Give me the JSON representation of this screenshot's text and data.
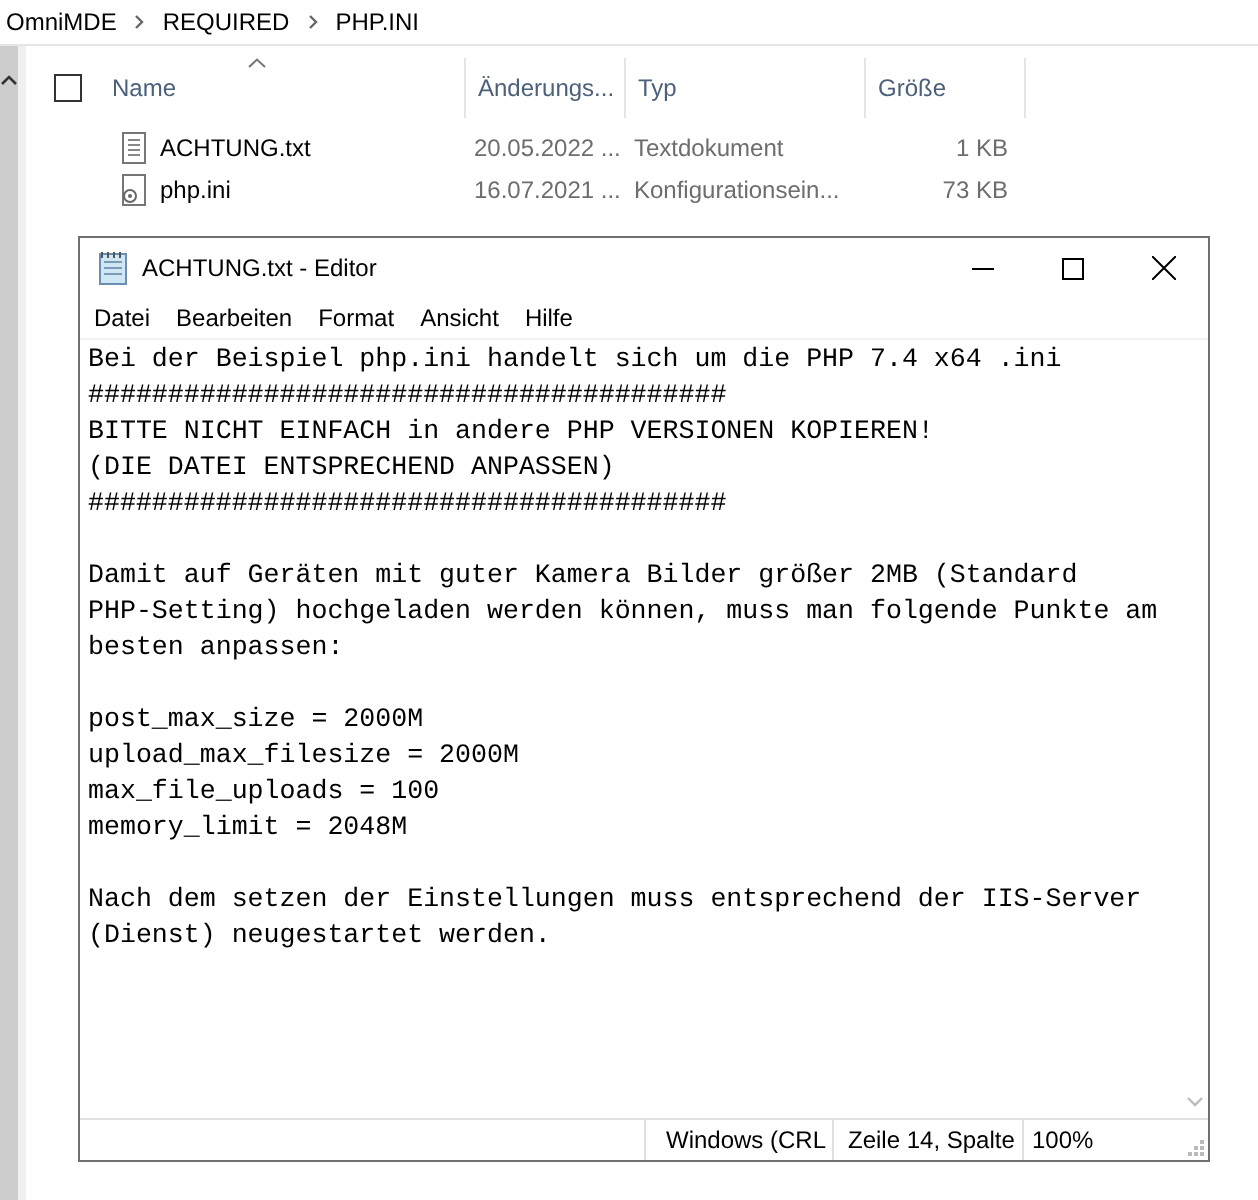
{
  "breadcrumb": [
    "OmniMDE",
    "REQUIRED",
    "PHP.INI"
  ],
  "file_list": {
    "select_all": {
      "checked": false
    },
    "columns": [
      {
        "label": "Name",
        "sorted": true
      },
      {
        "label": "Änderungs...",
        "sorted": false
      },
      {
        "label": "Typ",
        "sorted": false
      },
      {
        "label": "Größe",
        "sorted": false
      }
    ],
    "rows": [
      {
        "kind": "text",
        "name": "ACHTUNG.txt",
        "date": "20.05.2022 ...",
        "type": "Textdokument",
        "size": "1 KB"
      },
      {
        "kind": "config",
        "name": "php.ini",
        "date": "16.07.2021 ...",
        "type": "Konfigurationsein...",
        "size": "73 KB"
      }
    ]
  },
  "editor": {
    "title": "ACHTUNG.txt - Editor",
    "menu": [
      "Datei",
      "Bearbeiten",
      "Format",
      "Ansicht",
      "Hilfe"
    ],
    "paragraphs": [
      [
        "Bei der Beispiel php.ini handelt sich um die PHP 7.4 x64 .ini",
        "########################################",
        "BITTE NICHT EINFACH in andere PHP VERSIONEN KOPIEREN!",
        "(DIE DATEI ENTSPRECHEND ANPASSEN)",
        "########################################"
      ],
      [
        "Damit auf Geräten mit guter Kamera Bilder größer 2MB (Standard",
        "PHP-Setting) hochgeladen werden können, muss man folgende Punkte am",
        "besten anpassen:"
      ],
      [
        "post_max_size = 2000M",
        "upload_max_filesize = 2000M",
        "max_file_uploads = 100",
        "memory_limit = 2048M"
      ],
      [
        "Nach dem setzen der Einstellungen muss entsprechend der IIS-Server",
        "(Dienst) neugestartet werden."
      ]
    ],
    "status": [
      "Windows (CRL",
      "Zeile 14, Spalte",
      "100%"
    ]
  }
}
